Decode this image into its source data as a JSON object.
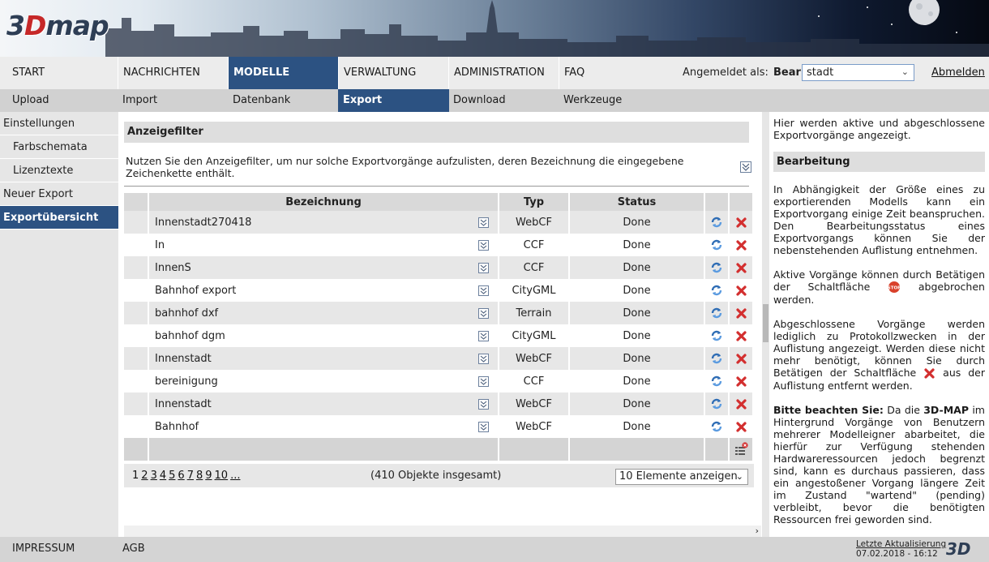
{
  "logo": {
    "prefix": "3",
    "d": "D",
    "suffix": "map"
  },
  "nav_primary": [
    {
      "label": "START",
      "active": false
    },
    {
      "label": "NACHRICHTEN",
      "active": false
    },
    {
      "label": "MODELLE",
      "active": true
    },
    {
      "label": "VERWALTUNG",
      "active": false
    },
    {
      "label": "ADMINISTRATION",
      "active": false
    },
    {
      "label": "FAQ",
      "active": false
    }
  ],
  "login": {
    "label": "Angemeldet als:",
    "name": "Bear",
    "value": "stadt",
    "logout": "Abmelden"
  },
  "nav_secondary": [
    {
      "label": "Upload",
      "active": false
    },
    {
      "label": "Import",
      "active": false
    },
    {
      "label": "Datenbank",
      "active": false
    },
    {
      "label": "Export",
      "active": true
    },
    {
      "label": "Download",
      "active": false
    },
    {
      "label": "Werkzeuge",
      "active": false
    }
  ],
  "sidebar": [
    {
      "label": "Einstellungen",
      "sub": false,
      "active": false
    },
    {
      "label": "Farbschemata",
      "sub": true,
      "active": false
    },
    {
      "label": "Lizenztexte",
      "sub": true,
      "active": false
    },
    {
      "label": "Neuer Export",
      "sub": false,
      "active": false
    },
    {
      "label": "Exportübersicht",
      "sub": false,
      "active": true
    }
  ],
  "filter": {
    "title": "Anzeigefilter",
    "text": "Nutzen Sie den Anzeigefilter, um nur solche Exportvorgänge aufzulisten, deren Bezeichnung die eingegebene Zeichenkette enthält."
  },
  "table": {
    "headers": {
      "name": "Bezeichnung",
      "type": "Typ",
      "status": "Status"
    },
    "rows": [
      {
        "name": "Innenstadt270418",
        "type": "WebCF",
        "status": "Done"
      },
      {
        "name": "In",
        "type": "CCF",
        "status": "Done"
      },
      {
        "name": "InnenS",
        "type": "CCF",
        "status": "Done"
      },
      {
        "name": "Bahnhof export",
        "type": "CityGML",
        "status": "Done"
      },
      {
        "name": "bahnhof dxf",
        "type": "Terrain",
        "status": "Done"
      },
      {
        "name": "bahnhof dgm",
        "type": "CityGML",
        "status": "Done"
      },
      {
        "name": "Innenstadt",
        "type": "WebCF",
        "status": "Done"
      },
      {
        "name": "bereinigung",
        "type": "CCF",
        "status": "Done"
      },
      {
        "name": "Innenstadt",
        "type": "WebCF",
        "status": "Done"
      },
      {
        "name": "Bahnhof",
        "type": "WebCF",
        "status": "Done"
      }
    ]
  },
  "pager": {
    "pages": [
      "1",
      "2",
      "3",
      "4",
      "5",
      "6",
      "7",
      "8",
      "9",
      "10",
      "..."
    ],
    "total": "(410 Objekte insgesamt)",
    "per_page": "10 Elemente anzeigen"
  },
  "help": {
    "intro": "Hier werden aktive und abgeschlossene Exportvorgänge angezeigt.",
    "heading": "Bearbeitung",
    "p1": "In Abhängigkeit der Größe eines zu exportierenden Modells kann ein Exportvorgang einige Zeit beanspruchen. Den Bearbeitungsstatus eines Exportvorgangs können Sie der nebenstehenden Auflistung entnehmen.",
    "p2a": "Aktive Vorgänge können durch Betätigen der Schaltfläche",
    "p2b": "abgebrochen werden.",
    "p3a": "Abgeschlossene Vorgänge werden lediglich zu Protokollzwecken in der Auflistung angezeigt. Werden diese nicht mehr benötigt, können Sie durch Betätigen der Schaltfläche",
    "p3b": "aus der Auflistung entfernt werden.",
    "p4_lead": "Bitte beachten Sie:",
    "p4a": "Da die",
    "p4_brand": "3D-MAP",
    "p4b": "im Hintergrund Vorgänge von Benutzern mehrerer Modelleigner abarbeitet, die hierfür zur Verfügung stehenden Hardwareressourcen jedoch begrenzt sind, kann es durchaus passieren, dass ein angestoßener Vorgang längere Zeit im Zustand \"wartend\" (pending) verbleibt, bevor die benötigten Ressourcen frei geworden sind."
  },
  "footer": {
    "impressum": "IMPRESSUM",
    "agb": "AGB",
    "update_label": "Letzte Aktualisierung",
    "update_date": "07.02.2018 - 16:12",
    "logo_prefix": "3",
    "logo_suffix": "D"
  },
  "colors": {
    "accent": "#2c5282",
    "delete": "#d32f2f",
    "refresh": "#2f6db5"
  }
}
